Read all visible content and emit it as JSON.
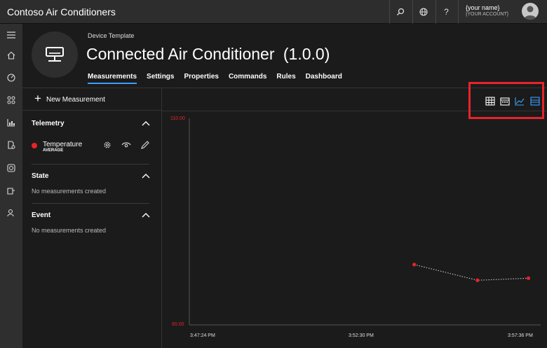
{
  "app": {
    "title": "Contoso Air Conditioners"
  },
  "topbar": {
    "user_name": "{your name}",
    "user_account": "{YOUR ACCOUNT}",
    "icons": [
      "search-icon",
      "globe-icon",
      "help-icon"
    ]
  },
  "leftnav": {
    "icons": [
      "hamburger-menu-icon",
      "home-icon",
      "dashboard-gauge-icon",
      "devices-icon",
      "analytics-icon",
      "device-template-icon",
      "device-sets-icon",
      "jobs-icon",
      "administration-icon"
    ]
  },
  "header": {
    "breadcrumb": "Device Template",
    "title": "Connected Air Conditioner",
    "version": "(1.0.0)",
    "tabs": [
      {
        "label": "Measurements",
        "active": true
      },
      {
        "label": "Settings"
      },
      {
        "label": "Properties"
      },
      {
        "label": "Commands"
      },
      {
        "label": "Rules"
      },
      {
        "label": "Dashboard"
      }
    ]
  },
  "panel": {
    "new_measurement": "New Measurement",
    "telemetry": {
      "title": "Telemetry",
      "item_label": "Temperature",
      "item_sub": "AVERAGE",
      "item_color": "#e8232a"
    },
    "state": {
      "title": "State",
      "empty": "No measurements created"
    },
    "event": {
      "title": "Event",
      "empty": "No measurements created"
    }
  },
  "chart_toolbar": {
    "icons": [
      "grid-view-icon",
      "calendar-icon",
      "line-chart-icon",
      "settings-panel-icon"
    ],
    "highlight_color": "#e8232a"
  },
  "chart_data": {
    "type": "line",
    "series": [
      {
        "values": [
          [
            0.64,
            74.6
          ],
          [
            0.82,
            70.8
          ],
          [
            0.965,
            71.3
          ]
        ],
        "color": "#e8232a"
      }
    ],
    "y_tick_labels": [
      "110.00",
      "60.00"
    ],
    "x_tick_labels": [
      "3:47:24 PM",
      "3:52:30 PM",
      "3:57:36 PM"
    ],
    "ylim": [
      60,
      110
    ]
  }
}
